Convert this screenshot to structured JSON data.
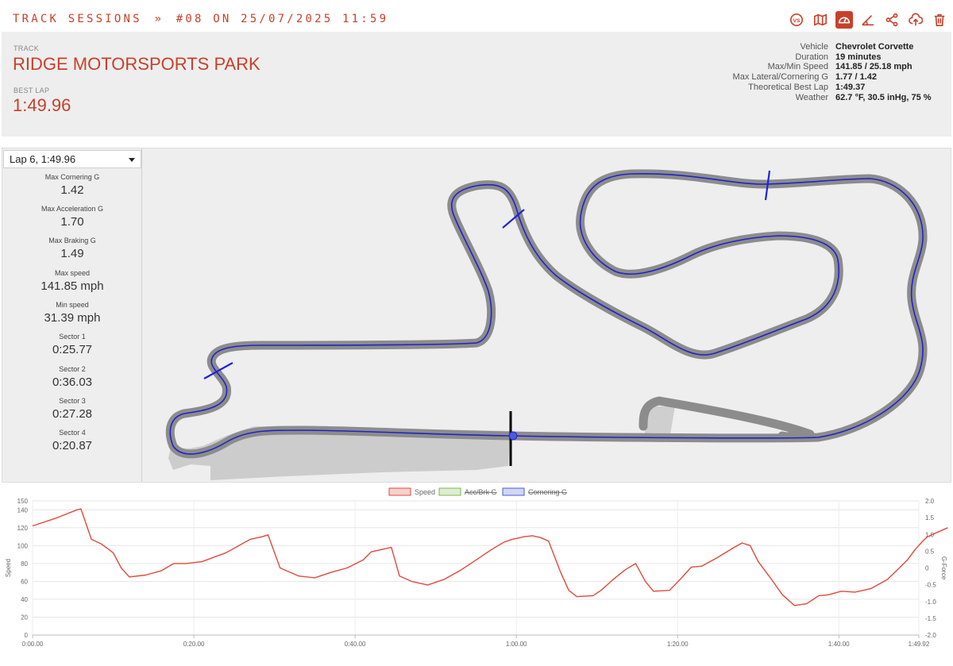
{
  "breadcrumb": {
    "section": "TRACK SESSIONS",
    "separator": "»",
    "session": "#08 ON 25/07/2025 11:59"
  },
  "toolbar": {
    "icons": [
      "vs-icon",
      "map-icon",
      "gauge-icon",
      "angle-icon",
      "share-icon",
      "cloud-upload-icon",
      "trash-icon"
    ],
    "active": "gauge-icon",
    "vs_label": "VS"
  },
  "header": {
    "track_label": "TRACK",
    "track_name": "RIDGE MOTORSPORTS PARK",
    "best_lap_label": "BEST LAP",
    "best_lap": "1:49.96",
    "stats": [
      {
        "label": "Vehicle",
        "value": "Chevrolet Corvette"
      },
      {
        "label": "Duration",
        "value": "19 minutes"
      },
      {
        "label": "Max/Min Speed",
        "value": "141.85 / 25.18 mph"
      },
      {
        "label": "Max Lateral/Cornering G",
        "value": "1.77 / 1.42"
      },
      {
        "label": "Theoretical Best Lap",
        "value": "1:49.37"
      },
      {
        "label": "Weather",
        "value": "62.7 °F, 30.5 inHg, 75 %"
      }
    ]
  },
  "lap_selector": {
    "selected": "Lap 6, 1:49.96"
  },
  "metrics": [
    {
      "label": "Max Cornering G",
      "value": "1.42"
    },
    {
      "label": "Max Acceleration G",
      "value": "1.70"
    },
    {
      "label": "Max Braking G",
      "value": "1.49"
    },
    {
      "label": "Max speed",
      "value": "141.85 mph"
    },
    {
      "label": "Min speed",
      "value": "31.39 mph"
    },
    {
      "label": "Sector 1",
      "value": "0:25.77"
    },
    {
      "label": "Sector 2",
      "value": "0:36.03"
    },
    {
      "label": "Sector 3",
      "value": "0:27.28"
    },
    {
      "label": "Sector 4",
      "value": "0:20.87"
    }
  ],
  "colors": {
    "accent": "#c9402a",
    "header_bg": "#eeeeee",
    "track": "#8c8c8c",
    "racing_line": "#2222cc",
    "sector_marker": "#2222dd",
    "finish_line": "#000000",
    "speed": "#e04a3c",
    "accbrk": "#7db84a",
    "cornering": "#4a5cd8"
  },
  "chart_data": {
    "type": "line",
    "legend": [
      {
        "name": "Speed",
        "hidden": false
      },
      {
        "name": "Acc/Brk G",
        "hidden": true
      },
      {
        "name": "Cornering G",
        "hidden": true
      }
    ],
    "legend_position": "top",
    "ylabel": "Speed",
    "y2label": "G-Force",
    "ylim": [
      0,
      150
    ],
    "y2lim": [
      -2.0,
      2.0
    ],
    "yticks": [
      "0",
      "20",
      "40",
      "60",
      "80",
      "100",
      "120",
      "140",
      "150"
    ],
    "y2ticks": [
      "-2.0",
      "-1.5",
      "-1.0",
      "-0.5",
      "0",
      "0.5",
      "1.0",
      "1.5",
      "2.0"
    ],
    "xticks": [
      "0:00.00",
      "0:20.00",
      "0:40.00",
      "1:00.00",
      "1:20.00",
      "1:40.00",
      "1:49.92"
    ],
    "xlim_seconds": [
      0,
      109.92
    ],
    "grid": true,
    "series": [
      {
        "name": "Speed",
        "points": [
          [
            0,
            122
          ],
          [
            3,
            131
          ],
          [
            5.5,
            140
          ],
          [
            6,
            141
          ],
          [
            7.3,
            107
          ],
          [
            8.5,
            102
          ],
          [
            10,
            92
          ],
          [
            11,
            75
          ],
          [
            12,
            65
          ],
          [
            14,
            67
          ],
          [
            16,
            72
          ],
          [
            17.5,
            80
          ],
          [
            19,
            80
          ],
          [
            21,
            82
          ],
          [
            24,
            92
          ],
          [
            27,
            107
          ],
          [
            28.5,
            110
          ],
          [
            29.2,
            112
          ],
          [
            30.7,
            75
          ],
          [
            33,
            66
          ],
          [
            35,
            64
          ],
          [
            37,
            70
          ],
          [
            39,
            75
          ],
          [
            41,
            84
          ],
          [
            42,
            93
          ],
          [
            43.5,
            96
          ],
          [
            44.5,
            98
          ],
          [
            45.5,
            66
          ],
          [
            47,
            60
          ],
          [
            49,
            56
          ],
          [
            51,
            62
          ],
          [
            53,
            72
          ],
          [
            55,
            84
          ],
          [
            57,
            96
          ],
          [
            58.5,
            104
          ],
          [
            59.5,
            107
          ],
          [
            61,
            110
          ],
          [
            62,
            111
          ],
          [
            63,
            109
          ],
          [
            64,
            105
          ],
          [
            65.5,
            70
          ],
          [
            66.5,
            50
          ],
          [
            67.5,
            43
          ],
          [
            69.5,
            44
          ],
          [
            70.5,
            50
          ],
          [
            72,
            62
          ],
          [
            73.5,
            73
          ],
          [
            74.8,
            80
          ],
          [
            76,
            60
          ],
          [
            77,
            49
          ],
          [
            79,
            50
          ],
          [
            80.5,
            64
          ],
          [
            81.7,
            76
          ],
          [
            83,
            77
          ],
          [
            85,
            87
          ],
          [
            87,
            98
          ],
          [
            88,
            103
          ],
          [
            89,
            100
          ],
          [
            90,
            82
          ],
          [
            91.5,
            64
          ],
          [
            93,
            45
          ],
          [
            94.5,
            33
          ],
          [
            96,
            35
          ],
          [
            97.5,
            44
          ],
          [
            98.7,
            45
          ],
          [
            100.3,
            49
          ],
          [
            102,
            48
          ],
          [
            104,
            52
          ],
          [
            106,
            62
          ],
          [
            107.5,
            75
          ],
          [
            108.5,
            84
          ],
          [
            109.5,
            96
          ],
          [
            110.5,
            106
          ],
          [
            111,
            110
          ],
          [
            112.5,
            116
          ],
          [
            113.5,
            120
          ]
        ]
      }
    ]
  }
}
